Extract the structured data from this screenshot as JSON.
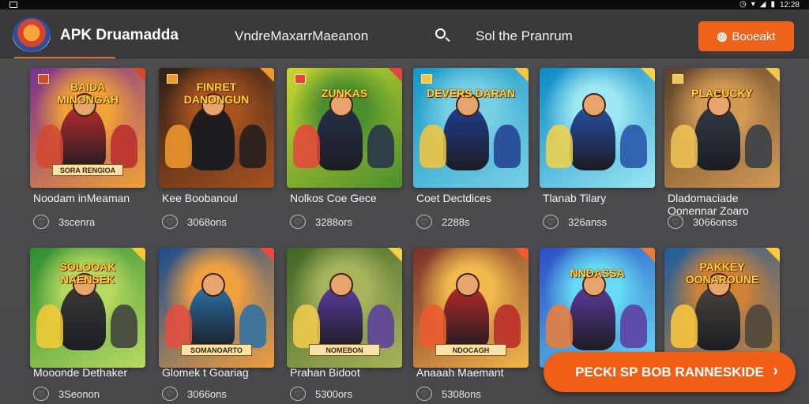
{
  "status_bar": {
    "time": "12:28"
  },
  "app": {
    "name": "APK Druamadda",
    "nav": [
      "VndreMaxarrMaeanon",
      "Sol the Pranrum"
    ],
    "header_button": "Booeakt",
    "floating_button": "PECKI SP BOB RANNESKIDE"
  },
  "sections": [
    {
      "cards": [
        {
          "title": "Noodam inMeaman",
          "art_title": "BAIDA MINONGAH",
          "banner": "SORA RENGIOA",
          "meta": "3scenra",
          "palette": {
            "bg1": "#7b2f8e",
            "bg2": "#f1a238",
            "accent": "#d4492f",
            "hero": "#b82b2d"
          }
        },
        {
          "title": "Kee Boobanoul",
          "art_title": "FINRET DANONGUN",
          "banner": "",
          "meta": "3068ons",
          "palette": {
            "bg1": "#2f2118",
            "bg2": "#a7521f",
            "accent": "#f29a2e",
            "hero": "#1e1c1c"
          }
        },
        {
          "title": "Nolkos Coe Gece",
          "art_title": "ZUNKAS",
          "banner": "",
          "meta": "3288ors",
          "palette": {
            "bg1": "#c9d62f",
            "bg2": "#4c8f2e",
            "accent": "#e8443b",
            "hero": "#24304a"
          }
        },
        {
          "title": "Coet Dectdices",
          "art_title": "DEVERS DARAN",
          "banner": "",
          "meta": "2288s",
          "palette": {
            "bg1": "#1697c4",
            "bg2": "#79d0e5",
            "accent": "#f6c63c",
            "hero": "#213d8f"
          }
        },
        {
          "title": "Tlanab Tilary",
          "art_title": "",
          "banner": "",
          "meta": "326anss",
          "palette": {
            "bg1": "#0a8ac8",
            "bg2": "#9ce7f2",
            "accent": "#f5d346",
            "hero": "#2650a6"
          }
        },
        {
          "title": "Dladomaciade Oonennar Zoaro",
          "art_title": "PLACUCKY",
          "banner": "",
          "meta": "3066onss",
          "palette": {
            "bg1": "#5b4028",
            "bg2": "#d39a55",
            "accent": "#f2c653",
            "hero": "#333b45"
          }
        }
      ]
    },
    {
      "cards": [
        {
          "title": "Mooonde Dethaker",
          "art_title": "SOLOOAK NAENSEK",
          "banner": "",
          "meta": "3Seonon",
          "palette": {
            "bg1": "#2c8d31",
            "bg2": "#b9da62",
            "accent": "#f7cb36",
            "hero": "#3b3b3b"
          }
        },
        {
          "title": "Glomek t Goariag",
          "art_title": "",
          "banner": "SOMANOARTO",
          "meta": "3066ons",
          "palette": {
            "bg1": "#1b4b8c",
            "bg2": "#f1a040",
            "accent": "#e84c3d",
            "hero": "#2a70a8"
          }
        },
        {
          "title": "Prahan Bidoot",
          "art_title": "",
          "banner": "NOMEBON",
          "meta": "5300ors",
          "palette": {
            "bg1": "#3f6525",
            "bg2": "#a8b45c",
            "accent": "#f5cf4b",
            "hero": "#5a3ca0"
          }
        },
        {
          "title": "Anaaah Maemant",
          "art_title": "",
          "banner": "NDOCAGH",
          "meta": "5308ons",
          "palette": {
            "bg1": "#7a2f28",
            "bg2": "#f0b84d",
            "accent": "#ed5b2f",
            "hero": "#b82828"
          }
        },
        {
          "title": "",
          "art_title": "NNDASSA",
          "banner": "",
          "meta": "",
          "palette": {
            "bg1": "#2b4cc5",
            "bg2": "#66dbf3",
            "accent": "#ef7b35",
            "hero": "#5c3a9d"
          }
        },
        {
          "title": "",
          "art_title": "PAKKEY OONAROUNE",
          "banner": "",
          "meta": "",
          "palette": {
            "bg1": "#1d5d9f",
            "bg2": "#d08334",
            "accent": "#ffc93c",
            "hero": "#49443c"
          }
        }
      ]
    }
  ]
}
